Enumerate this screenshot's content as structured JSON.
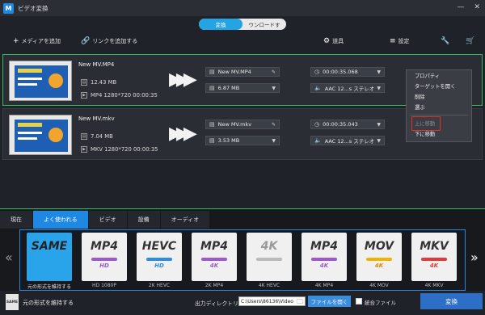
{
  "app": {
    "title": "ビデオ変換",
    "logo_letter": "M"
  },
  "mode_tabs": [
    {
      "label": "変換",
      "active": true
    },
    {
      "label": "ウンロードす",
      "active": false
    }
  ],
  "toolbar": {
    "add_media": "メディアを追加",
    "add_link": "リンクを追加する",
    "tools": "道具",
    "settings": "設定"
  },
  "tasks": [
    {
      "name": "New MV.MP4",
      "size": "12.43 MB",
      "info": "MP4 1280*720 00:00:35",
      "out_name": "New MV.MP4",
      "out_size": "6.87 MB",
      "duration": "00:00:35.068",
      "audio": "AAC 12...s ステレオ",
      "selected": true
    },
    {
      "name": "New MV.mkv",
      "size": "7.04 MB",
      "info": "MKV 1280*720 00:00:35",
      "out_name": "New MV.mkv",
      "out_size": "3.53 MB",
      "duration": "00:00:35.043",
      "audio": "AAC 12...s ステレオ",
      "selected": false
    }
  ],
  "context_menu": {
    "items": [
      {
        "label": "プロパティ",
        "disabled": false
      },
      {
        "label": "ターゲットを開く",
        "disabled": false
      },
      {
        "label": "削除",
        "disabled": false
      },
      {
        "label": "選ぶ",
        "disabled": false
      },
      {
        "label": "上に移動",
        "disabled": true
      },
      {
        "label": "下に移動",
        "disabled": false
      }
    ]
  },
  "format_tabs": [
    {
      "label": "現在",
      "active": false
    },
    {
      "label": "よく使われる",
      "active": true
    },
    {
      "label": "ビデオ",
      "active": false
    },
    {
      "label": "設備",
      "active": false
    },
    {
      "label": "オーディオ",
      "active": false
    }
  ],
  "formats": [
    {
      "name": "SAME",
      "quality": "",
      "caption": "元の形式を維持する",
      "bar_color": "",
      "selected": true
    },
    {
      "name": "MP4",
      "quality": "HD",
      "caption": "HD 1080P",
      "bar_color": "#9b59d0",
      "selected": false
    },
    {
      "name": "HEVC",
      "quality": "HD",
      "caption": "2K HEVC",
      "bar_color": "#2d8de0",
      "selected": false
    },
    {
      "name": "MP4",
      "quality": "4K",
      "caption": "2K MP4",
      "bar_color": "#9b59d0",
      "selected": false
    },
    {
      "name": "4K",
      "quality": "",
      "caption": "4K HEVC",
      "bar_color": "#bbbbbb",
      "selected": false
    },
    {
      "name": "MP4",
      "quality": "4K",
      "caption": "4K MP4",
      "bar_color": "#9b59d0",
      "selected": false
    },
    {
      "name": "MOV",
      "quality": "4K",
      "caption": "4K MOV",
      "bar_color": "#f0b400",
      "selected": false
    },
    {
      "name": "MKV",
      "quality": "4K",
      "caption": "4K MKV",
      "bar_color": "#e03a3a",
      "selected": false
    }
  ],
  "status": {
    "small_icon": "SAME",
    "keep_format": "元の形式を維持する",
    "output_label": "出力ディレクトリ",
    "output_path": "C:\\Users\\86136\\Video",
    "open_file": "ファイルを開く",
    "merge": "統合ファイル",
    "convert": "変換"
  },
  "colors": {
    "accent": "#1e88e5",
    "selected_border": "#2fbf5a",
    "menu_highlight": "#e0302e"
  }
}
